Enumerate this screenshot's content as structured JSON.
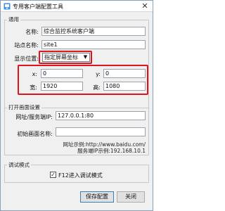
{
  "window": {
    "title": "专用客户端配置工具",
    "close_glyph": "✕"
  },
  "general": {
    "legend": "通用",
    "name_label": "名称:",
    "name_value": "综合监控系统客户端",
    "site_label": "站点名称:",
    "site_value": "site1",
    "display_label": "显示位置:",
    "display_value": "指定屏幕坐标",
    "x_label": "x:",
    "x_value": "0",
    "y_label": "y:",
    "y_value": "0",
    "width_label": "宽:",
    "width_value": "1920",
    "height_label": "高:",
    "height_value": "1080"
  },
  "open_page": {
    "legend": "打开画面设置",
    "url_label": "网址/服务端IP:",
    "url_value": "127.0.0.1:80",
    "init_label": "初始画面名称:",
    "init_value": "",
    "hint_url": "网址示例:http://www.baidu.com/",
    "hint_ip": "服务端IP示例:192.168.10.1"
  },
  "debug": {
    "legend": "调试模式",
    "checkbox_label": "F12进入调试模式",
    "checked": true
  },
  "buttons": {
    "save": "保存配置",
    "close": "关闭"
  },
  "colors": {
    "highlight": "#e0141e",
    "window_bg": "#f0f0f0"
  }
}
